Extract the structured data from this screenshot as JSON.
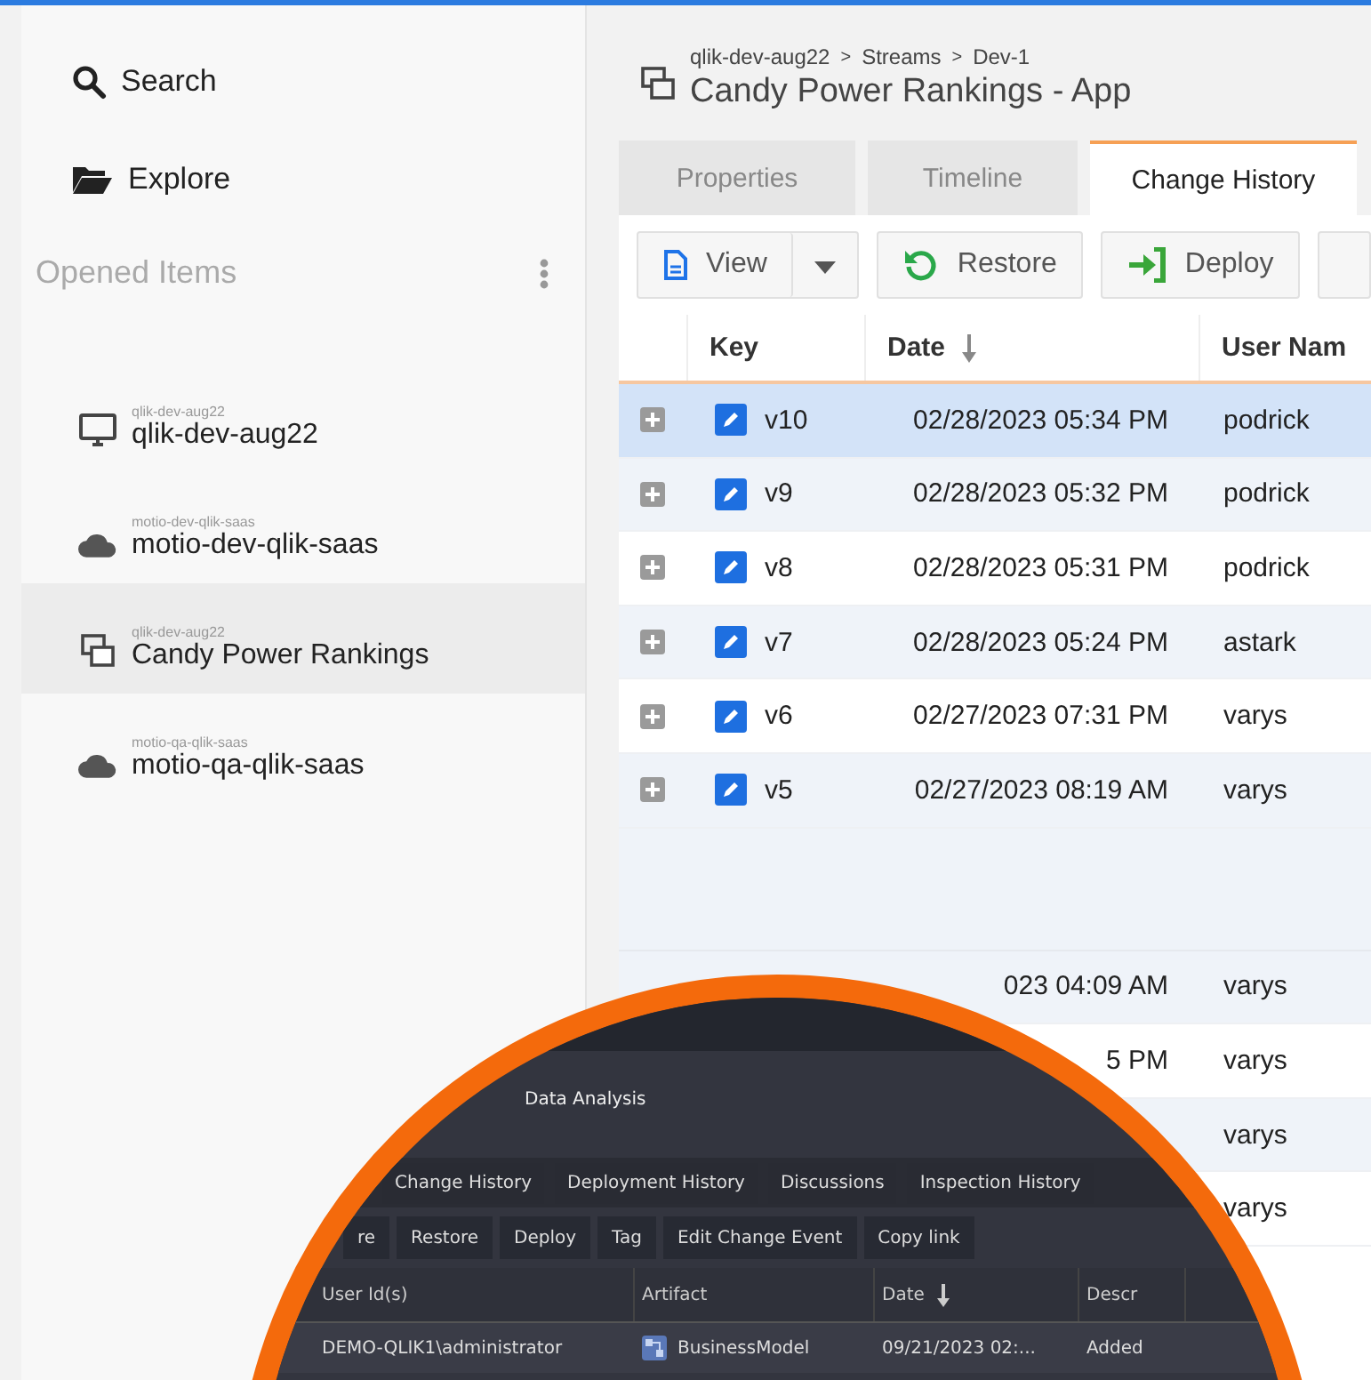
{
  "sidebar": {
    "nav": [
      {
        "label": "Search",
        "kind": "search"
      },
      {
        "label": "Explore",
        "kind": "folder"
      }
    ],
    "section_title": "Opened Items",
    "opened_items": [
      {
        "caption": "qlik-dev-aug22",
        "name": "qlik-dev-aug22",
        "kind": "server",
        "selected": false
      },
      {
        "caption": "motio-dev-qlik-saas",
        "name": "motio-dev-qlik-saas",
        "kind": "cloud",
        "selected": false
      },
      {
        "caption": "qlik-dev-aug22",
        "name": "Candy Power Rankings",
        "kind": "app",
        "selected": true
      },
      {
        "caption": "motio-qa-qlik-saas",
        "name": "motio-qa-qlik-saas",
        "kind": "cloud",
        "selected": false
      }
    ]
  },
  "header": {
    "breadcrumb": [
      "qlik-dev-aug22",
      "Streams",
      "Dev-1"
    ],
    "separator": ">",
    "title": "Candy Power Rankings - App"
  },
  "tabs": [
    {
      "label": "Properties",
      "selected": false
    },
    {
      "label": "Timeline",
      "selected": false
    },
    {
      "label": "Change History",
      "selected": true
    }
  ],
  "toolbar": [
    {
      "label": "View",
      "kind": "split"
    },
    {
      "label": "Restore",
      "kind": "restore"
    },
    {
      "label": "Deploy",
      "kind": "deploy"
    },
    {
      "kind": "partial"
    }
  ],
  "table": {
    "columns": [
      {
        "label": "Key",
        "sorted": false
      },
      {
        "label": "Date",
        "sorted": true
      },
      {
        "label": "User Nam",
        "sorted": false
      }
    ],
    "rows": [
      {
        "key": "v10",
        "date": "02/28/2023 05:34 PM",
        "user": "podrick",
        "selected": true
      },
      {
        "key": "v9",
        "date": "02/28/2023 05:32 PM",
        "user": "podrick",
        "selected": false
      },
      {
        "key": "v8",
        "date": "02/28/2023 05:31 PM",
        "user": "podrick",
        "selected": false
      },
      {
        "key": "v7",
        "date": "02/28/2023 05:24 PM",
        "user": "astark",
        "selected": false
      },
      {
        "key": "v6",
        "date": "02/27/2023 07:31 PM",
        "user": "varys",
        "selected": false
      },
      {
        "key": "v5",
        "date": "02/27/2023 08:19 AM",
        "user": "varys",
        "selected": false
      }
    ],
    "covered_rows": [
      {
        "date": "023 04:09 AM",
        "user": "varys"
      },
      {
        "date": "5 PM",
        "user": "varys"
      },
      {
        "user": "varys"
      },
      {
        "user": "varys"
      }
    ]
  },
  "inset": {
    "title": "Data Analysis",
    "tabs": [
      "Change History",
      "Deployment History",
      "Discussions",
      "Inspection History"
    ],
    "buttons": [
      "re",
      "Restore",
      "Deploy",
      "Tag",
      "Edit Change Event",
      "Copy link"
    ],
    "columns": [
      {
        "label": "User Id(s)",
        "sorted": false
      },
      {
        "label": "Artifact",
        "sorted": false
      },
      {
        "label": "Date",
        "sorted": true
      },
      {
        "label": "Descr",
        "sorted": false
      }
    ],
    "rows": [
      {
        "user_id": "DEMO-QLIK1\\administrator",
        "artifact": "BusinessModel",
        "date": "09/21/2023 02:...",
        "description": "Added"
      }
    ]
  }
}
